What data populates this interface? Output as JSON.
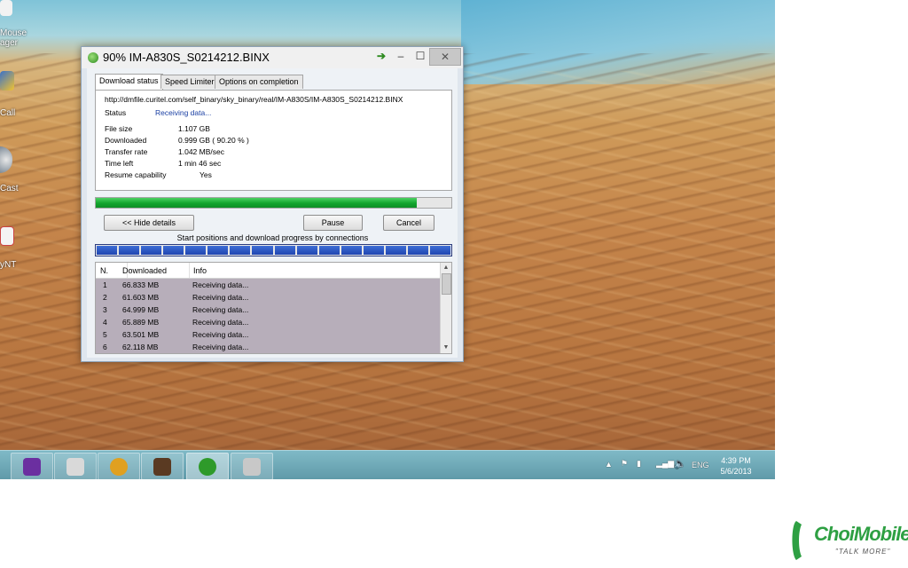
{
  "desktop": {
    "icons": [
      {
        "label": "Mouse\nager",
        "icon": "mouse-app-icon"
      },
      {
        "label": "Call",
        "icon": "shield-call-icon"
      },
      {
        "label": "Cast",
        "icon": "cast-icon"
      },
      {
        "label": "yNT",
        "icon": "app-icon"
      }
    ]
  },
  "window": {
    "title": "90% IM-A830S_S0214212.BINX",
    "tabs": [
      "Download status",
      "Speed Limiter",
      "Options on completion"
    ],
    "url": "http://dmfile.curitel.com/self_binary/sky_binary/real/IM-A830S/IM-A830S_S0214212.BINX",
    "status_label": "Status",
    "status_value": "Receiving data...",
    "file_size_label": "File size",
    "file_size_value": "1.107  GB",
    "downloaded_label": "Downloaded",
    "downloaded_value": "0.999  GB  ( 90.20 % )",
    "transfer_rate_label": "Transfer rate",
    "transfer_rate_value": "1.042  MB/sec",
    "time_left_label": "Time left",
    "time_left_value": "1 min 46 sec",
    "resume_label": "Resume capability",
    "resume_value": "Yes",
    "progress_fraction": 0.902,
    "hide_details_label": "<< Hide details",
    "pause_label": "Pause",
    "cancel_label": "Cancel",
    "connections_caption": "Start positions and download progress by connections",
    "connection_segments": 16,
    "list_headers": [
      "N.",
      "Downloaded",
      "Info"
    ],
    "connections": [
      {
        "n": "1",
        "downloaded": "66.833  MB",
        "info": "Receiving data..."
      },
      {
        "n": "2",
        "downloaded": "61.603  MB",
        "info": "Receiving data..."
      },
      {
        "n": "3",
        "downloaded": "64.999  MB",
        "info": "Receiving data..."
      },
      {
        "n": "4",
        "downloaded": "65.889  MB",
        "info": "Receiving data..."
      },
      {
        "n": "5",
        "downloaded": "63.501  MB",
        "info": "Receiving data..."
      },
      {
        "n": "6",
        "downloaded": "62.118  MB",
        "info": "Receiving data..."
      }
    ]
  },
  "taskbar": {
    "items": [
      {
        "icon": "yahoo-messenger-icon",
        "color": "#6b2fa0"
      },
      {
        "icon": "network-icon",
        "color": "#d9d9d9"
      },
      {
        "icon": "chrome-icon",
        "color": "#e0a020"
      },
      {
        "icon": "game-icon",
        "color": "#5a3a22"
      },
      {
        "icon": "download-manager-icon",
        "color": "#2e9a2a"
      },
      {
        "icon": "paint-icon",
        "color": "#c8c8c8"
      }
    ],
    "language": "ENG",
    "time": "4:39 PM",
    "date": "5/6/2013"
  },
  "watermark": {
    "brand": "ChoiMobile",
    "tagline": "\"TALK MORE\""
  }
}
